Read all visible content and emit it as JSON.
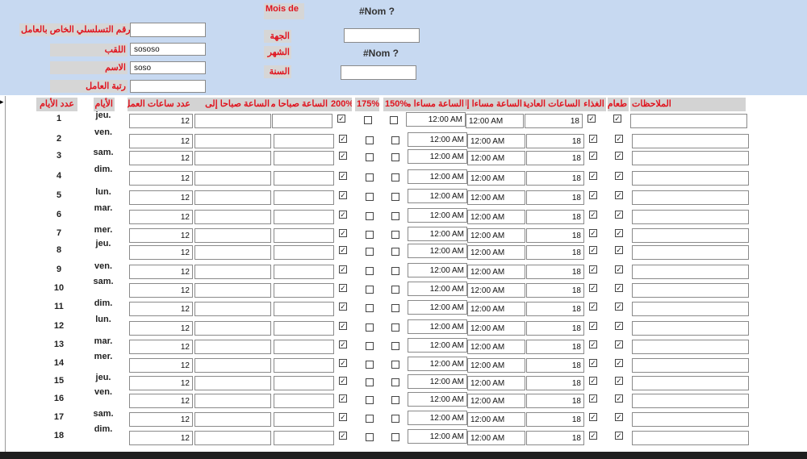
{
  "header": {
    "serial_label": "لرقم التسلسلي الخاص بالعامل",
    "surname_label": "اللقب",
    "surname_value": "sososo",
    "name_label": "الاسم",
    "name_value": "soso",
    "rank_label": "رتبة العامل",
    "mois_label": "Mois de",
    "nom_top": "#Nom ?",
    "dept_label": "الجهة",
    "month_label": "الشهر",
    "nom_mid": "#Nom ?",
    "year_label": "السنة"
  },
  "columns": {
    "days_count": "عدد الأيام",
    "days": "الأيام",
    "hours": "عدد ساعات العمل",
    "morning_to": "الساعة صباحا إلى",
    "morning_from": "الساعة صباحا من",
    "p200": "200%",
    "p175": "175%",
    "p150": "150%",
    "evening_from": "الساعة مساءا من",
    "evening_to": "الساعة مساءا إلى",
    "normal_hours": "الساعات العادية",
    "lunch": "الغذاء",
    "food": "طعام",
    "notes": "الملاحظات"
  },
  "rows": [
    {
      "n": "1",
      "day": "jeu.",
      "hours": "12",
      "ev_from": "12:00 AM",
      "ev_to": "12:00 AM",
      "normal": "18",
      "c200": true,
      "c175": false,
      "c150": false,
      "lunch": true,
      "food": true
    },
    {
      "n": "2",
      "day": "ven.",
      "hours": "12",
      "ev_from": "12:00 AM",
      "ev_to": "12:00 AM",
      "normal": "18",
      "c200": true,
      "c175": false,
      "c150": false,
      "lunch": true,
      "food": true
    },
    {
      "n": "3",
      "day": "sam.",
      "hours": "12",
      "ev_from": "12:00 AM",
      "ev_to": "12:00 AM",
      "normal": "18",
      "c200": true,
      "c175": false,
      "c150": false,
      "lunch": true,
      "food": true
    },
    {
      "n": "4",
      "day": "dim.",
      "hours": "12",
      "ev_from": "12:00 AM",
      "ev_to": "12:00 AM",
      "normal": "18",
      "c200": true,
      "c175": false,
      "c150": false,
      "lunch": true,
      "food": true
    },
    {
      "n": "5",
      "day": "lun.",
      "hours": "12",
      "ev_from": "12:00 AM",
      "ev_to": "12:00 AM",
      "normal": "18",
      "c200": true,
      "c175": false,
      "c150": false,
      "lunch": true,
      "food": true
    },
    {
      "n": "6",
      "day": "mar.",
      "hours": "12",
      "ev_from": "12:00 AM",
      "ev_to": "12:00 AM",
      "normal": "18",
      "c200": true,
      "c175": false,
      "c150": false,
      "lunch": true,
      "food": true
    },
    {
      "n": "7",
      "day": "mer.",
      "hours": "12",
      "ev_from": "12:00 AM",
      "ev_to": "12:00 AM",
      "normal": "18",
      "c200": true,
      "c175": false,
      "c150": false,
      "lunch": true,
      "food": true
    },
    {
      "n": "8",
      "day": "jeu.",
      "hours": "12",
      "ev_from": "12:00 AM",
      "ev_to": "12:00 AM",
      "normal": "18",
      "c200": true,
      "c175": false,
      "c150": false,
      "lunch": true,
      "food": true
    },
    {
      "n": "9",
      "day": "ven.",
      "hours": "12",
      "ev_from": "12:00 AM",
      "ev_to": "12:00 AM",
      "normal": "18",
      "c200": true,
      "c175": false,
      "c150": false,
      "lunch": true,
      "food": true
    },
    {
      "n": "10",
      "day": "sam.",
      "hours": "12",
      "ev_from": "12:00 AM",
      "ev_to": "12:00 AM",
      "normal": "18",
      "c200": true,
      "c175": false,
      "c150": false,
      "lunch": true,
      "food": true
    },
    {
      "n": "11",
      "day": "dim.",
      "hours": "12",
      "ev_from": "12:00 AM",
      "ev_to": "12:00 AM",
      "normal": "18",
      "c200": true,
      "c175": false,
      "c150": false,
      "lunch": true,
      "food": true
    },
    {
      "n": "12",
      "day": "lun.",
      "hours": "12",
      "ev_from": "12:00 AM",
      "ev_to": "12:00 AM",
      "normal": "18",
      "c200": true,
      "c175": false,
      "c150": false,
      "lunch": true,
      "food": true
    },
    {
      "n": "13",
      "day": "mar.",
      "hours": "12",
      "ev_from": "12:00 AM",
      "ev_to": "12:00 AM",
      "normal": "18",
      "c200": true,
      "c175": false,
      "c150": false,
      "lunch": true,
      "food": true
    },
    {
      "n": "14",
      "day": "mer.",
      "hours": "12",
      "ev_from": "12:00 AM",
      "ev_to": "12:00 AM",
      "normal": "18",
      "c200": true,
      "c175": false,
      "c150": false,
      "lunch": true,
      "food": true
    },
    {
      "n": "15",
      "day": "jeu.",
      "hours": "12",
      "ev_from": "12:00 AM",
      "ev_to": "12:00 AM",
      "normal": "18",
      "c200": true,
      "c175": false,
      "c150": false,
      "lunch": true,
      "food": true
    },
    {
      "n": "16",
      "day": "ven.",
      "hours": "12",
      "ev_from": "12:00 AM",
      "ev_to": "12:00 AM",
      "normal": "18",
      "c200": true,
      "c175": false,
      "c150": false,
      "lunch": true,
      "food": true
    },
    {
      "n": "17",
      "day": "sam.",
      "hours": "12",
      "ev_from": "12:00 AM",
      "ev_to": "12:00 AM",
      "normal": "18",
      "c200": true,
      "c175": false,
      "c150": false,
      "lunch": true,
      "food": true
    },
    {
      "n": "18",
      "day": "dim.",
      "hours": "12",
      "ev_from": "12:00 AM",
      "ev_to": "12:00 AM",
      "normal": "18",
      "c200": true,
      "c175": false,
      "c150": false,
      "lunch": true,
      "food": true
    }
  ]
}
